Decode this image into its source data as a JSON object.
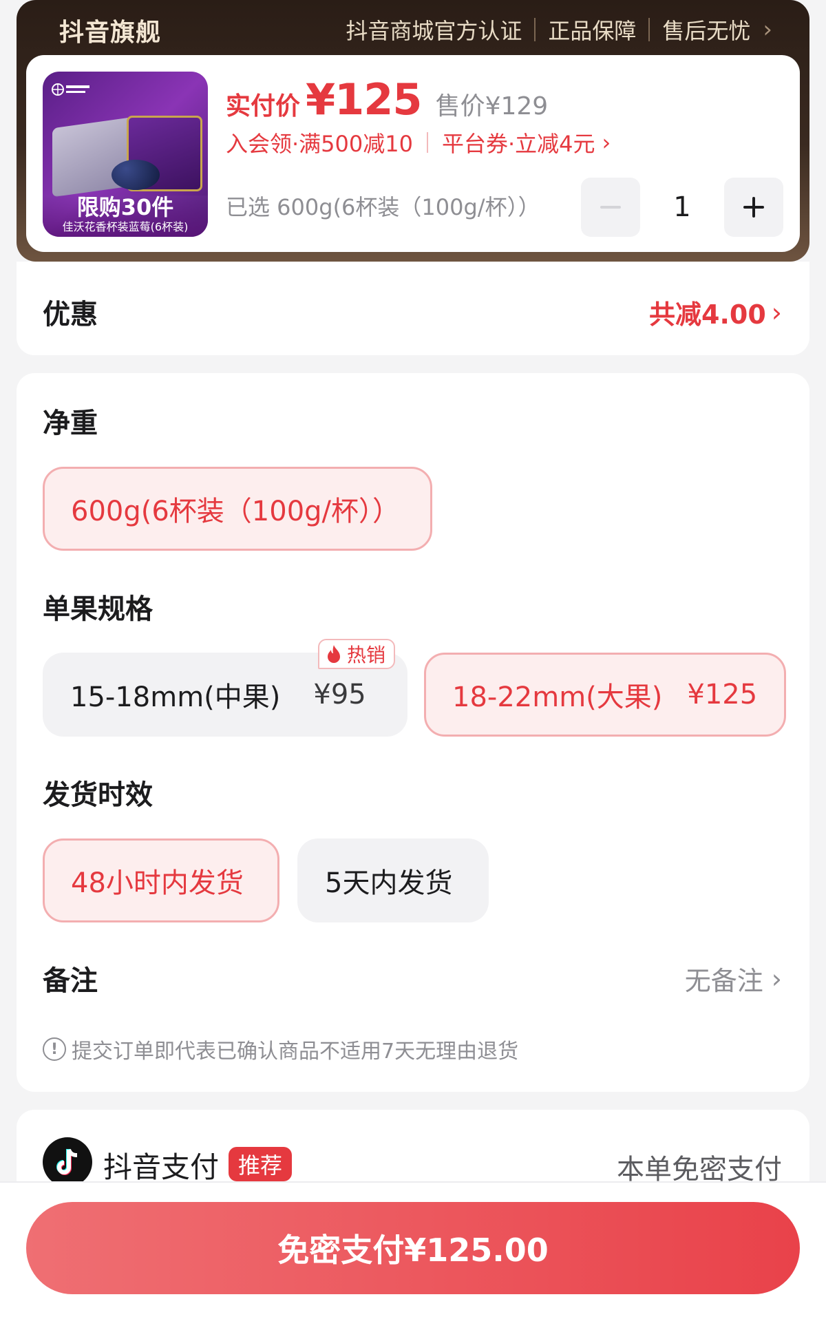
{
  "store": {
    "name": "抖音旗舰",
    "badges": [
      "抖音商城官方认证",
      "正品保障",
      "售后无忧"
    ]
  },
  "product": {
    "image_logo": "佳沃\nJOYVIO",
    "image_limit_text": "限购30件",
    "image_sub_text": "佳沃花香杯装蓝莓(6杯装)",
    "price_label": "实付价",
    "price_value": "¥125",
    "original_price": "售价¥129",
    "promo_member": "入会领·满500减10",
    "promo_coupon": "平台券·立减4元",
    "selected_text": "已选 600g(6杯装（100g/杯））",
    "quantity": "1"
  },
  "discount": {
    "label": "优惠",
    "value": "共减4.00"
  },
  "specs": {
    "net_weight": {
      "title": "净重",
      "options": [
        {
          "label": "600g(6杯装（100g/杯））",
          "selected": true
        }
      ]
    },
    "fruit_size": {
      "title": "单果规格",
      "hot_tag": "热销",
      "options": [
        {
          "label": "15-18mm(中果)",
          "price": "¥95",
          "selected": false
        },
        {
          "label": "18-22mm(大果)",
          "price": "¥125",
          "selected": true
        }
      ]
    },
    "shipping": {
      "title": "发货时效",
      "options": [
        {
          "label": "48小时内发货",
          "selected": true
        },
        {
          "label": "5天内发货",
          "selected": false
        }
      ]
    },
    "remark": {
      "label": "备注",
      "value": "无备注"
    },
    "notice": "提交订单即代表已确认商品不适用7天无理由退货"
  },
  "payment": {
    "name": "抖音支付",
    "tag": "推荐",
    "note": "本单免密支付"
  },
  "bottom": {
    "pay_button": "免密支付¥125.00"
  },
  "colors": {
    "accent": "#e5393f",
    "selected_bg": "#fdeeee",
    "header_dark": "#2a1d16"
  }
}
